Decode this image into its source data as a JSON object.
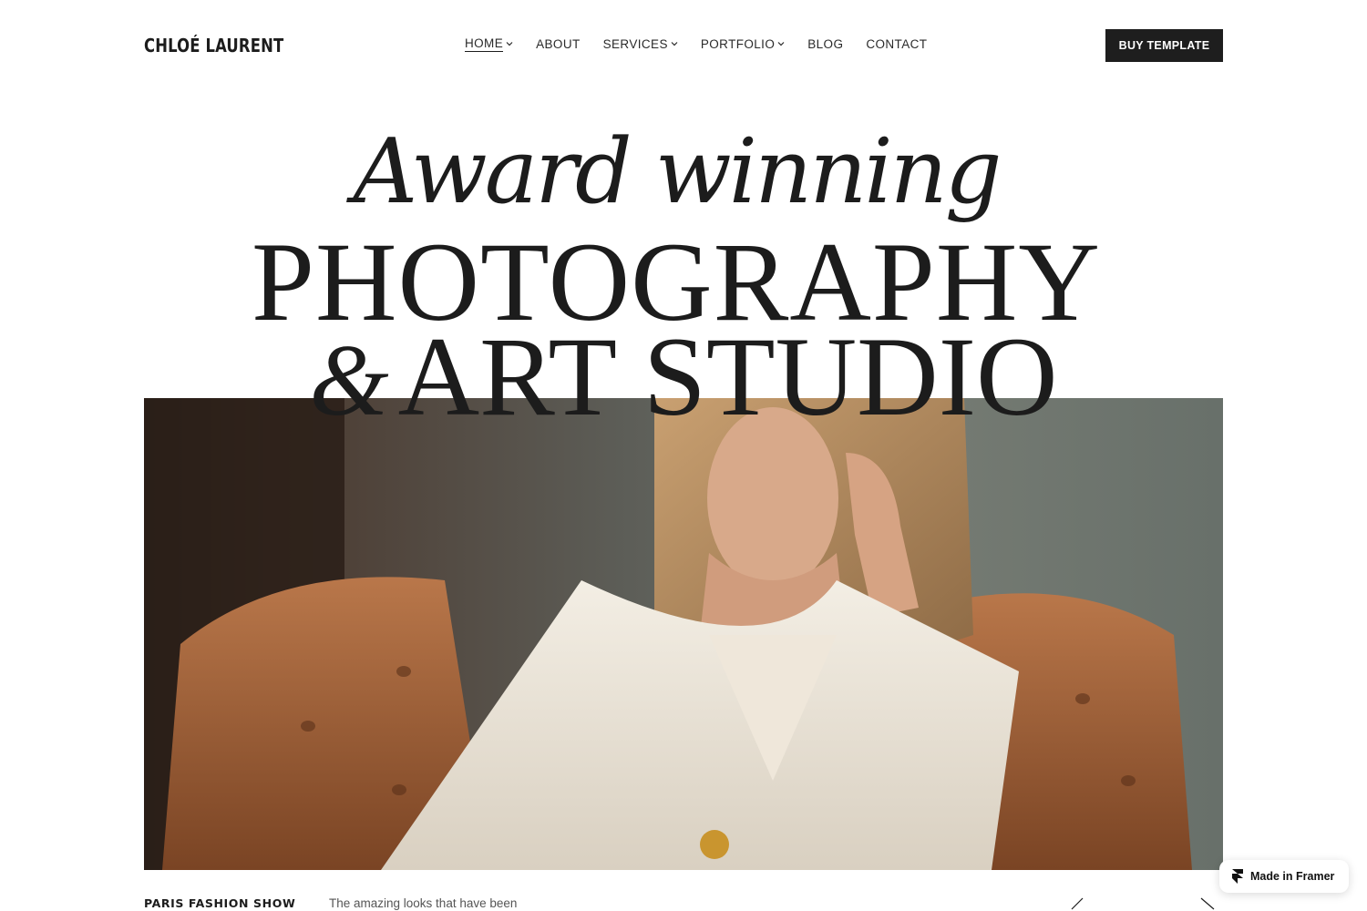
{
  "brand": {
    "name": "CHLOÉ LAURENT"
  },
  "nav": {
    "items": [
      {
        "label": "HOME",
        "has_dropdown": true,
        "active": true
      },
      {
        "label": "ABOUT",
        "has_dropdown": false
      },
      {
        "label": "SERVICES",
        "has_dropdown": true
      },
      {
        "label": "PORTFOLIO",
        "has_dropdown": true
      },
      {
        "label": "BLOG",
        "has_dropdown": false
      },
      {
        "label": "CONTACT",
        "has_dropdown": false
      }
    ]
  },
  "header": {
    "cta_label": "BUY TEMPLATE"
  },
  "hero": {
    "line1": "Award winning",
    "line2": "PHOTOGRAPHY",
    "line3_amp": "&",
    "line3_text": "ART STUDIO",
    "photo_icon": "portrait-photo"
  },
  "caption": {
    "title": "PARIS FASHION SHOW",
    "text": "The amazing looks that have been"
  },
  "slider": {
    "prev_icon": "arrow-left-icon",
    "next_icon": "arrow-right-icon"
  },
  "badge": {
    "label": "Made in Framer",
    "icon": "framer-logo-icon"
  },
  "colors": {
    "text": "#1c1c1c",
    "button_bg": "#1e1e1e",
    "background": "#ffffff"
  }
}
